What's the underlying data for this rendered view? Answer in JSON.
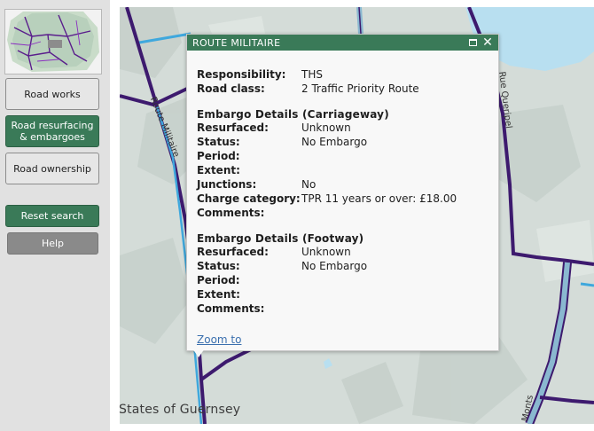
{
  "sidebar": {
    "buttons": [
      {
        "label": "Road works"
      },
      {
        "label": "Road resurfacing & embargoes"
      },
      {
        "label": "Road ownership"
      }
    ],
    "reset_label": "Reset search",
    "help_label": "Help"
  },
  "map": {
    "attribution": "States of Guernsey",
    "road_labels": [
      "Route Militaire",
      "Rue Queripel",
      "Monts"
    ]
  },
  "popup": {
    "title": "ROUTE MILITAIRE",
    "general": [
      {
        "label": "Responsibility:",
        "value": "THS"
      },
      {
        "label": "Road class:",
        "value": "2 Traffic Priority Route"
      }
    ],
    "carriageway": {
      "title": "Embargo Details (Carriageway)",
      "fields": [
        {
          "label": "Resurfaced:",
          "value": "Unknown"
        },
        {
          "label": "Status:",
          "value": "No Embargo"
        },
        {
          "label": "Period:",
          "value": ""
        },
        {
          "label": "Extent:",
          "value": ""
        },
        {
          "label": "Junctions:",
          "value": "No"
        },
        {
          "label": "Charge category:",
          "value": "TPR 11 years or over: £18.00"
        },
        {
          "label": "Comments:",
          "value": ""
        }
      ]
    },
    "footway": {
      "title": "Embargo Details (Footway)",
      "fields": [
        {
          "label": "Resurfaced:",
          "value": "Unknown"
        },
        {
          "label": "Status:",
          "value": "No Embargo"
        },
        {
          "label": "Period:",
          "value": ""
        },
        {
          "label": "Extent:",
          "value": ""
        },
        {
          "label": "Comments:",
          "value": ""
        }
      ]
    },
    "zoom_link": "Zoom to"
  },
  "colors": {
    "sidebar_bg": "#e1e1e1",
    "accent_green": "#3a7a58",
    "road_purple": "#3d1a6e",
    "road_light_blue": "#8ab8d0",
    "road_cyan": "#3fa8dd",
    "water": "#b8dff0",
    "land": "#d4dcd8"
  }
}
